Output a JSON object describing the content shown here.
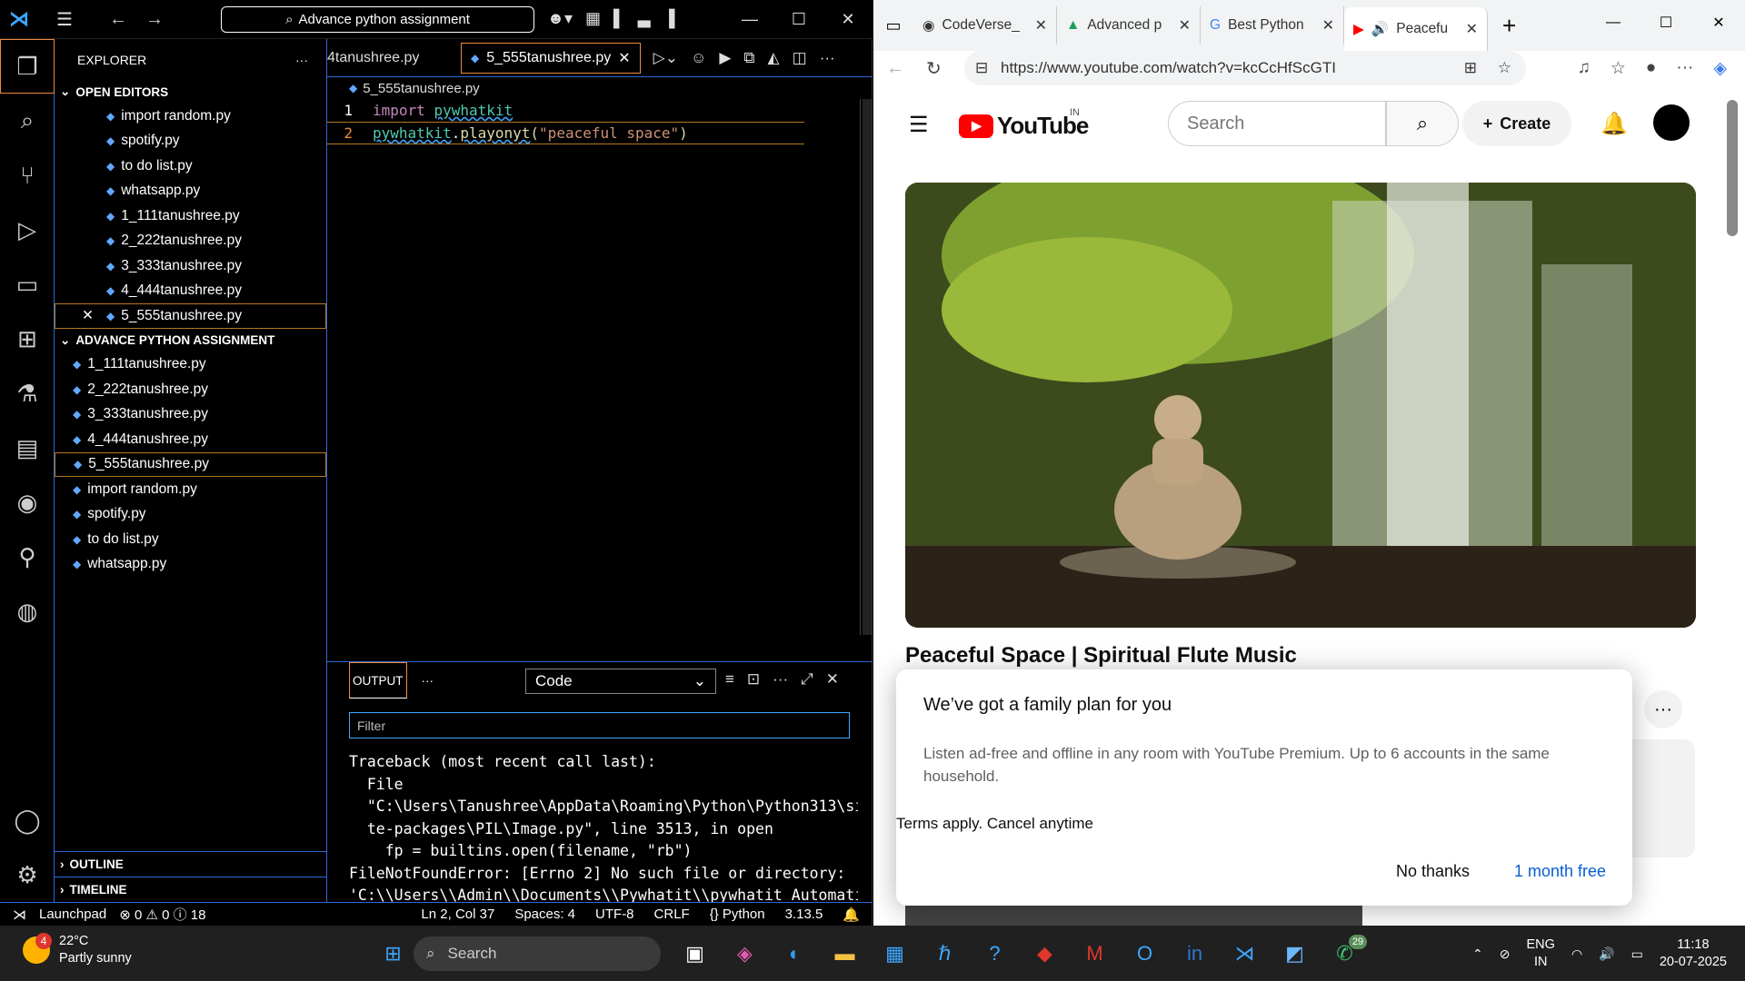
{
  "vscode": {
    "search": "Advance python assignment",
    "explorer_title": "EXPLORER",
    "open_editors": "OPEN EDITORS",
    "open_files": [
      "import random.py",
      "spotify.py",
      "to do list.py",
      "whatsapp.py",
      "1_111tanushree.py",
      "2_222tanushree.py",
      "3_333tanushree.py",
      "4_444tanushree.py",
      "5_555tanushree.py"
    ],
    "project": "ADVANCE PYTHON ASSIGNMENT",
    "project_files": [
      "1_111tanushree.py",
      "2_222tanushree.py",
      "3_333tanushree.py",
      "4_444tanushree.py",
      "5_555tanushree.py",
      "import random.py",
      "spotify.py",
      "to do list.py",
      "whatsapp.py"
    ],
    "outline": "OUTLINE",
    "timeline": "TIMELINE",
    "tab_prev": "4tanushree.py",
    "tab_active": "5_555tanushree.py",
    "breadcrumb": "5_555tanushree.py",
    "code": {
      "l1_num": "1",
      "l1_kw": "import",
      "l1_mod": "pywhatkit",
      "l2_num": "2",
      "l2_mod": "pywhatkit",
      "l2_dot": ".",
      "l2_fn": "playonyt",
      "l2_open": "(",
      "l2_str": "\"peaceful space\"",
      "l2_close": ")"
    },
    "panel_tab": "OUTPUT",
    "panel_select": "Code",
    "filter_placeholder": "Filter",
    "output": "Traceback (most recent call last):\n  File\n  \"C:\\Users\\Tanushree\\AppData\\Roaming\\Python\\Python313\\si\n  te-packages\\PIL\\Image.py\", line 3513, in open\n    fp = builtins.open(filename, \"rb\")\nFileNotFoundError: [Errno 2] No such file or directory:\n'C:\\\\Users\\\\Admin\\\\Documents\\\\Pywhatit\\\\pywhatit Automati",
    "status": {
      "launchpad": "Launchpad",
      "problems": "⊗ 0 ⚠ 0 ⓘ 18",
      "position": "Ln 2, Col 37",
      "spaces": "Spaces: 4",
      "encoding": "UTF-8",
      "eol": "CRLF",
      "language": "{} Python",
      "version": "3.13.5"
    }
  },
  "browser": {
    "tabs": [
      "CodeVerse_",
      "Advanced p",
      "Best Python",
      "Peacefu"
    ],
    "url": "https://www.youtube.com/watch?v=kcCcHfScGTI",
    "yt_logo": "YouTube",
    "yt_region": "IN",
    "search_placeholder": "Search",
    "create": "Create",
    "video_title": "Peaceful Space | Spiritual Flute Music",
    "dialog_title": "We’ve got a family plan for you",
    "dialog_body": "Listen ad-free and offline in any room with YouTube Premium. Up to 6 accounts in the same household.",
    "dialog_terms": "Terms apply. Cancel anytime",
    "dialog_no": "No thanks",
    "dialog_yes": "1 month free"
  },
  "taskbar": {
    "temp": "22°C",
    "weather": "Partly sunny",
    "weather_badge": "4",
    "search": "Search",
    "whatsapp_badge": "29",
    "lang1": "ENG",
    "lang2": "IN",
    "time": "11:18",
    "date": "20-07-2025"
  }
}
